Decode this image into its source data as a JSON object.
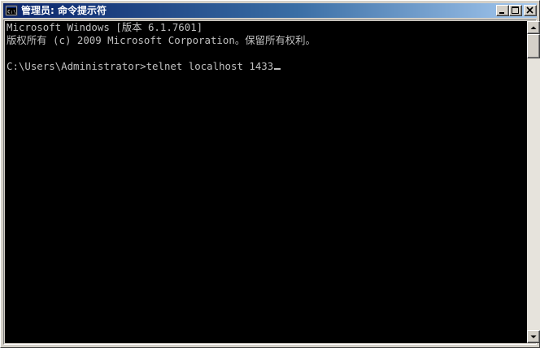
{
  "window": {
    "title": "管理员: 命令提示符",
    "icon": "cmd-icon",
    "buttons": [
      "minimize-icon",
      "maximize-icon",
      "close-icon"
    ]
  },
  "console": {
    "lines": [
      "Microsoft Windows [版本 6.1.7601]",
      "版权所有 (c) 2009 Microsoft Corporation。保留所有权利。",
      "C:\\Users\\Administrator>telnet localhost 1433"
    ],
    "text_color": "#c0c0c0",
    "background": "#000000"
  },
  "colors": {
    "titlebar_start": "#0a246a",
    "titlebar_end": "#a6caf0",
    "chrome": "#d4d0c8"
  }
}
